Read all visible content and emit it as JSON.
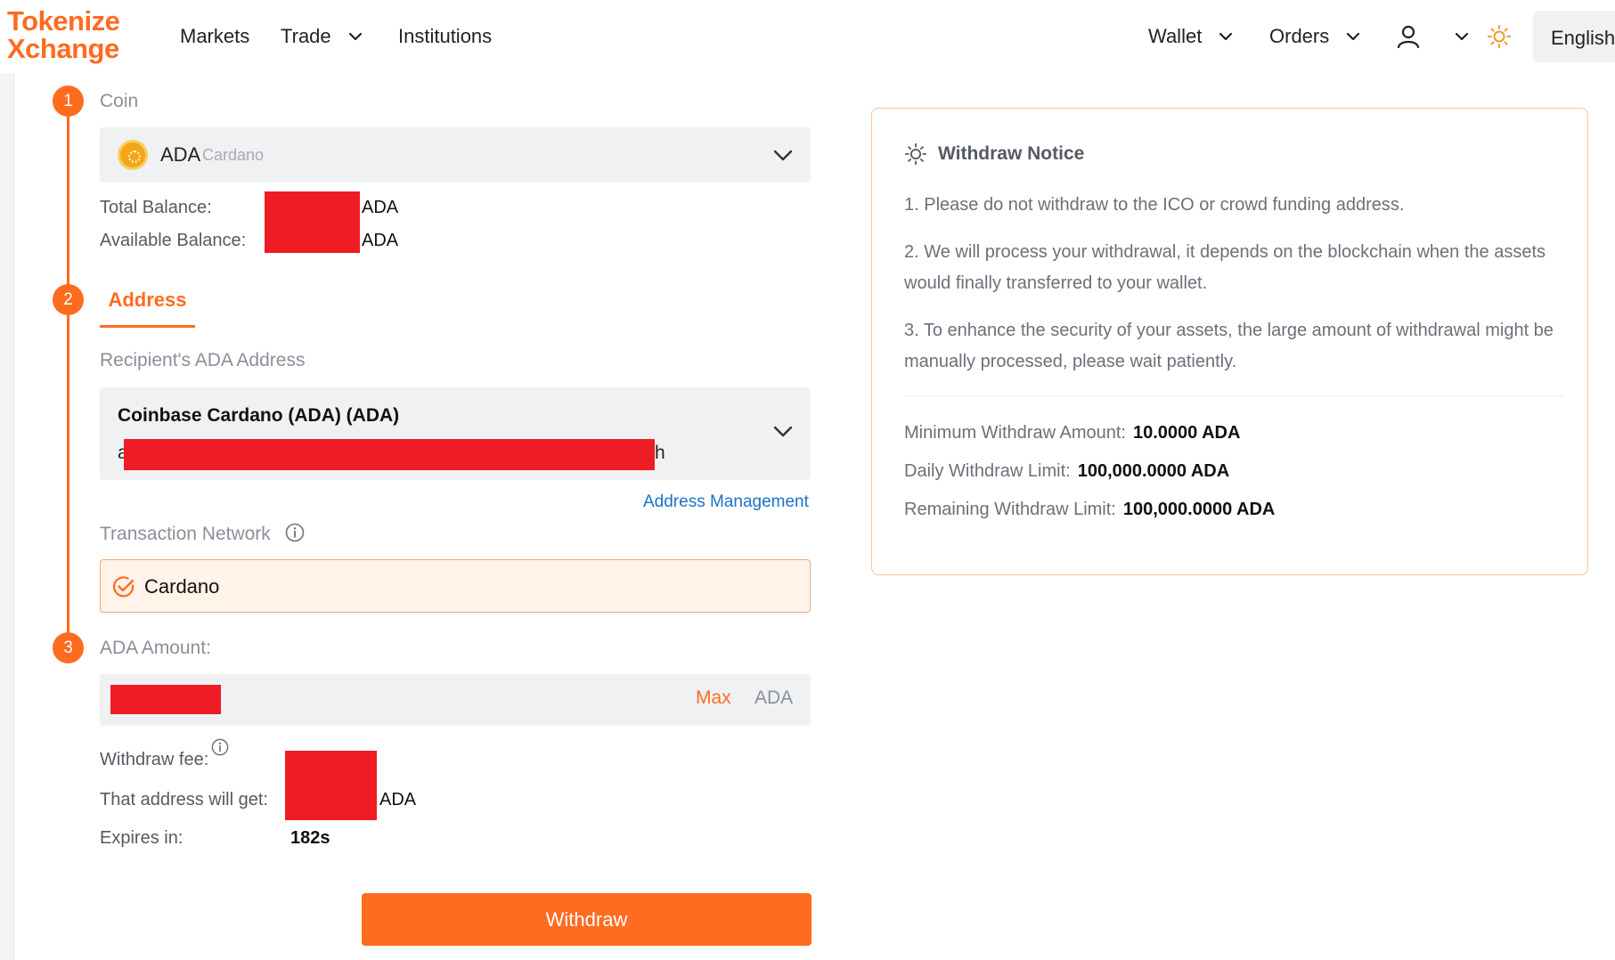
{
  "header": {
    "logo_line1": "Tokenize",
    "logo_line2": "Xchange",
    "nav": {
      "markets": "Markets",
      "trade": "Trade",
      "institutions": "Institutions",
      "wallet": "Wallet",
      "orders": "Orders"
    },
    "language": "English"
  },
  "steps": {
    "step1": "1",
    "step2": "2",
    "step3": "3"
  },
  "coin": {
    "label": "Coin",
    "symbol": "ADA",
    "name": "Cardano",
    "total_balance_label": "Total Balance:",
    "available_balance_label": "Available Balance:",
    "unit": "ADA"
  },
  "address": {
    "tab_label": "Address",
    "recipient_label": "Recipient's ADA Address",
    "selected_name": "Coinbase Cardano (ADA) (ADA)",
    "address_start": "a",
    "address_end": "h",
    "management_link": "Address Management",
    "network_label": "Transaction Network",
    "network_value": "Cardano"
  },
  "amount": {
    "label": "ADA Amount:",
    "max_label": "Max",
    "unit": "ADA",
    "fee_label": "Withdraw fee:",
    "receive_label": "That address will get:",
    "receive_unit": "ADA",
    "expires_label": "Expires in:",
    "expires_value": "182s"
  },
  "withdraw_button": "Withdraw",
  "notice": {
    "title": "Withdraw Notice",
    "items": [
      "1. Please do not withdraw to the ICO or crowd funding address.",
      "2. We will process your withdrawal, it depends on the blockchain when the assets would finally transferred to your wallet.",
      "3. To enhance the security of your assets, the large amount of withdrawal might be manually processed, please wait patiently."
    ],
    "min_label": "Minimum Withdraw Amount:",
    "min_value": "10.0000 ADA",
    "daily_label": "Daily Withdraw Limit:",
    "daily_value": "100,000.0000 ADA",
    "remaining_label": "Remaining Withdraw Limit:",
    "remaining_value": "100,000.0000 ADA"
  },
  "icons": {
    "user": "user-icon",
    "theme": "sun-icon",
    "notice": "sun-icon",
    "network_check": "check-circle-icon",
    "info": "info-icon"
  },
  "colors": {
    "accent": "#ff6b1f",
    "redaction": "#ee1c25",
    "link": "#1a73c8"
  }
}
